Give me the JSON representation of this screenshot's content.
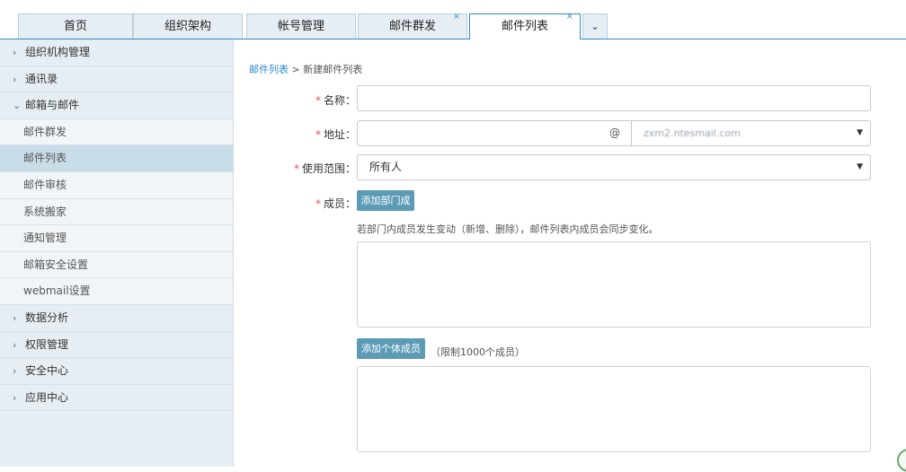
{
  "tabs": [
    {
      "label": "首页"
    },
    {
      "label": "组织架构"
    },
    {
      "label": "帐号管理"
    },
    {
      "label": "邮件群发",
      "close": "×"
    },
    {
      "label": "邮件列表",
      "close": "×"
    }
  ],
  "tab_more": "⌄",
  "sidebar": {
    "items": [
      {
        "label": "组织机构管理",
        "arrow": "›"
      },
      {
        "label": "通讯录",
        "arrow": "›"
      },
      {
        "label": "邮箱与邮件",
        "arrow": "⌄"
      },
      {
        "label": "邮件群发"
      },
      {
        "label": "邮件列表"
      },
      {
        "label": "邮件审核"
      },
      {
        "label": "系统搬家"
      },
      {
        "label": "通知管理"
      },
      {
        "label": "邮箱安全设置"
      },
      {
        "label": "webmail设置"
      },
      {
        "label": "数据分析",
        "arrow": "›"
      },
      {
        "label": "权限管理",
        "arrow": "›"
      },
      {
        "label": "安全中心",
        "arrow": "›"
      },
      {
        "label": "应用中心",
        "arrow": "›"
      }
    ]
  },
  "breadcrumb": {
    "link": "邮件列表",
    "sep": ">",
    "current": "新建邮件列表"
  },
  "form": {
    "required_mark": "*",
    "name_label": "名称：",
    "address_label": "地址：",
    "at_sign": "@",
    "domain_value": "zxm2.ntesmail.com",
    "scope_label": "使用范围：",
    "scope_value": "所有人",
    "members_label": "成员：",
    "add_dept_button": "添加部门成员",
    "dept_hint": "若部门内成员发生变动（新增、删除），邮件列表内成员会同步变化。",
    "add_person_button": "添加个体成员",
    "person_limit": "（限制1000个成员）"
  },
  "colors": {
    "accent": "#2e8bc9",
    "button": "#5b9bb5",
    "required": "#e05050",
    "sidebar_bg": "#e6eef4"
  },
  "icons": {
    "dropdown": "caret-down-icon",
    "collapsed": "chevron-right-icon",
    "expanded": "chevron-down-icon"
  }
}
